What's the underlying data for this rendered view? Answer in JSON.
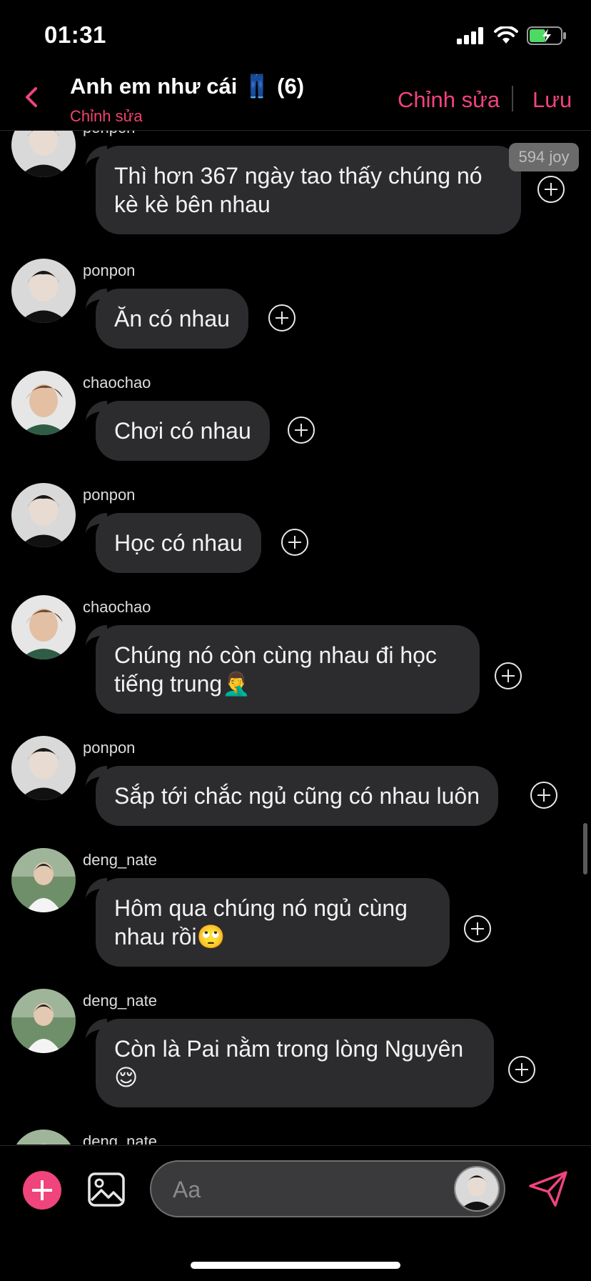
{
  "status": {
    "time": "01:31"
  },
  "header": {
    "title": "Anh em như cái 👖 (6)",
    "subtitle": "Chỉnh sửa",
    "edit_label": "Chỉnh sửa",
    "save_label": "Lưu"
  },
  "reaction_badge": "594 joy",
  "messages": [
    {
      "sender": "ponpon",
      "text": "Thì hơn 367 ngày tao thấy chúng nó kè kè bên nhau"
    },
    {
      "sender": "ponpon",
      "text": "Ăn có nhau"
    },
    {
      "sender": "chaochao",
      "text": "Chơi có nhau"
    },
    {
      "sender": "ponpon",
      "text": "Học có nhau"
    },
    {
      "sender": "chaochao",
      "text": "Chúng nó còn cùng nhau đi học tiếng trung🤦‍♂️"
    },
    {
      "sender": "ponpon",
      "text": "Sắp tới chắc ngủ cũng có nhau luôn"
    },
    {
      "sender": "deng_nate",
      "text": "Hôm qua chúng nó ngủ cùng nhau rồi🙄"
    },
    {
      "sender": "deng_nate",
      "text": "Còn là Pai nằm trong lòng Nguyên 😌"
    },
    {
      "sender": "deng_nate",
      "text": ""
    }
  ],
  "composer": {
    "placeholder": "Aa"
  },
  "colors": {
    "accent": "#f0447d",
    "bubble": "#2c2c2e",
    "background": "#000000"
  }
}
